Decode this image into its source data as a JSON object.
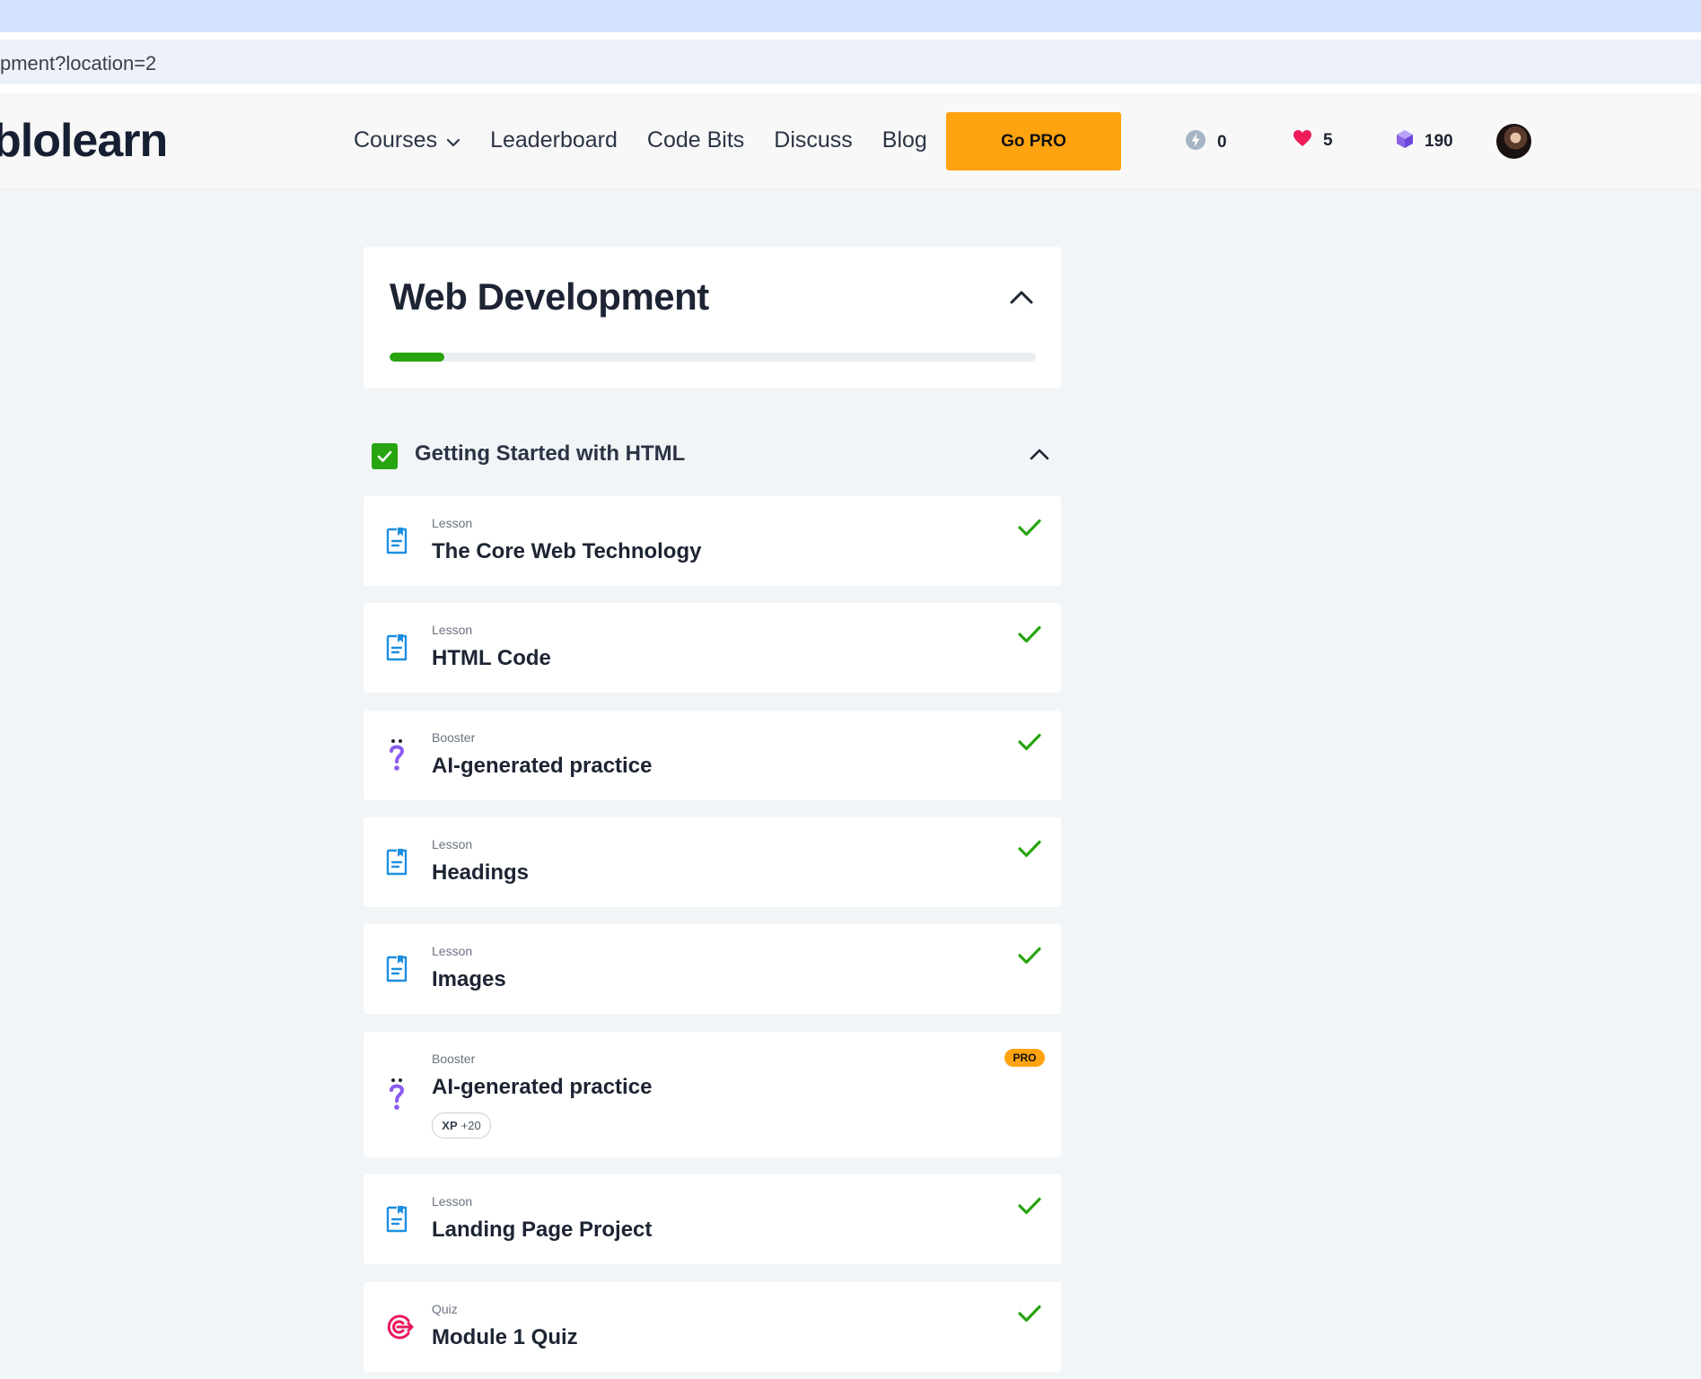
{
  "browser": {
    "url_fragment": "pment?location=2"
  },
  "header": {
    "logo": "blolearn",
    "nav": [
      {
        "label": "Courses",
        "has_dropdown": true
      },
      {
        "label": "Leaderboard"
      },
      {
        "label": "Code Bits"
      },
      {
        "label": "Discuss"
      },
      {
        "label": "Blog"
      }
    ],
    "go_pro_label": "Go PRO",
    "stats": {
      "streak": "0",
      "hearts": "5",
      "bits": "190"
    },
    "colors": {
      "go_pro_bg": "#ffa310",
      "heart": "#ee1b5a",
      "bit": "#8a63e6",
      "streak": "#a6b4c4"
    }
  },
  "course": {
    "title": "Web Development",
    "progress_fraction": 0.085,
    "progress_color": "#27a40f"
  },
  "module": {
    "title": "Getting Started with HTML",
    "completed": true
  },
  "items": [
    {
      "type": "Lesson",
      "title": "The Core Web Technology",
      "icon": "lesson-icon",
      "completed": true
    },
    {
      "type": "Lesson",
      "title": "HTML Code",
      "icon": "lesson-icon",
      "completed": true
    },
    {
      "type": "Booster",
      "title": "AI-generated practice",
      "icon": "booster-icon",
      "completed": true
    },
    {
      "type": "Lesson",
      "title": "Headings",
      "icon": "lesson-icon",
      "completed": true
    },
    {
      "type": "Lesson",
      "title": "Images",
      "icon": "lesson-icon",
      "completed": true
    },
    {
      "type": "Booster",
      "title": "AI-generated practice",
      "icon": "booster-icon",
      "completed": false,
      "badge": "PRO",
      "xp_label": "XP",
      "xp_value": "+20"
    },
    {
      "type": "Lesson",
      "title": "Landing Page Project",
      "icon": "lesson-icon",
      "completed": true
    },
    {
      "type": "Quiz",
      "title": "Module 1 Quiz",
      "icon": "quiz-icon",
      "completed": true
    }
  ]
}
